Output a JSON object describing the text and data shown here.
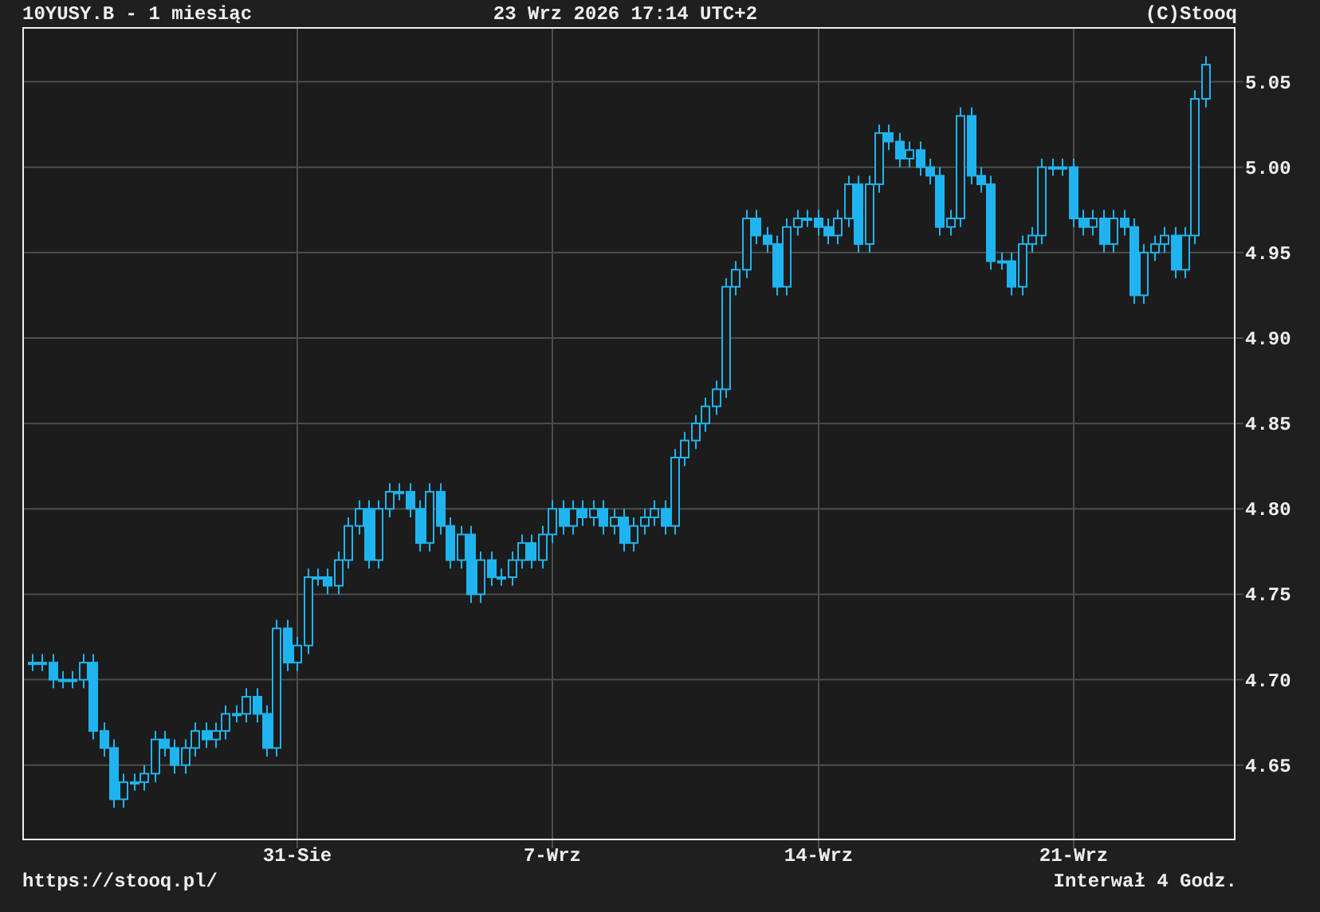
{
  "header": {
    "title": "10YUSY.B - 1 miesiąc",
    "timestamp": "23 Wrz 2026 17:14 UTC+2",
    "copyright": "(C)Stooq"
  },
  "chart": {
    "chart_data": {
      "type": "candlestick",
      "grid": true,
      "ylim": [
        4.606,
        5.082
      ],
      "yticks": [
        {
          "value": 4.65,
          "label": "4.65"
        },
        {
          "value": 4.7,
          "label": "4.70"
        },
        {
          "value": 4.75,
          "label": "4.75"
        },
        {
          "value": 4.8,
          "label": "4.80"
        },
        {
          "value": 4.85,
          "label": "4.85"
        },
        {
          "value": 4.9,
          "label": "4.90"
        },
        {
          "value": 4.95,
          "label": "4.95"
        },
        {
          "value": 5,
          "label": "5.00"
        },
        {
          "value": 5.05,
          "label": "5.05"
        }
      ],
      "categories": [
        null,
        null,
        null,
        null,
        null,
        null,
        null,
        null,
        null,
        null,
        null,
        null,
        null,
        null,
        null,
        null,
        null,
        null,
        null,
        null,
        null,
        null,
        null,
        null,
        null,
        null,
        "31-Sie",
        null,
        null,
        null,
        null,
        null,
        null,
        null,
        null,
        null,
        null,
        null,
        null,
        null,
        null,
        null,
        null,
        null,
        null,
        null,
        null,
        null,
        null,
        null,
        null,
        "7-Wrz",
        null,
        null,
        null,
        null,
        null,
        null,
        null,
        null,
        null,
        null,
        null,
        null,
        null,
        null,
        null,
        null,
        null,
        null,
        null,
        null,
        null,
        null,
        null,
        null,
        null,
        "14-Wrz",
        null,
        null,
        null,
        null,
        null,
        null,
        null,
        null,
        null,
        null,
        null,
        null,
        null,
        null,
        null,
        null,
        null,
        null,
        null,
        null,
        null,
        null,
        null,
        null,
        "21-Wrz",
        null,
        null,
        null,
        null,
        null,
        null,
        null,
        null,
        null,
        null,
        null,
        null,
        null
      ],
      "color": "#1fb4ef",
      "ohlc": [
        [
          4.71,
          4.715,
          4.705,
          4.71
        ],
        [
          4.71,
          4.715,
          4.705,
          4.71
        ],
        [
          4.71,
          4.715,
          4.695,
          4.7
        ],
        [
          4.7,
          4.705,
          4.695,
          4.7
        ],
        [
          4.7,
          4.705,
          4.695,
          4.7
        ],
        [
          4.7,
          4.715,
          4.695,
          4.71
        ],
        [
          4.71,
          4.715,
          4.665,
          4.67
        ],
        [
          4.67,
          4.675,
          4.655,
          4.66
        ],
        [
          4.66,
          4.665,
          4.625,
          4.63
        ],
        [
          4.63,
          4.645,
          4.625,
          4.64
        ],
        [
          4.64,
          4.645,
          4.635,
          4.64
        ],
        [
          4.64,
          4.65,
          4.635,
          4.645
        ],
        [
          4.645,
          4.67,
          4.64,
          4.665
        ],
        [
          4.665,
          4.67,
          4.655,
          4.66
        ],
        [
          4.66,
          4.665,
          4.645,
          4.65
        ],
        [
          4.65,
          4.665,
          4.645,
          4.66
        ],
        [
          4.66,
          4.675,
          4.655,
          4.67
        ],
        [
          4.67,
          4.675,
          4.66,
          4.665
        ],
        [
          4.665,
          4.675,
          4.66,
          4.67
        ],
        [
          4.67,
          4.685,
          4.665,
          4.68
        ],
        [
          4.68,
          4.685,
          4.675,
          4.68
        ],
        [
          4.68,
          4.695,
          4.675,
          4.69
        ],
        [
          4.69,
          4.695,
          4.675,
          4.68
        ],
        [
          4.68,
          4.685,
          4.655,
          4.66
        ],
        [
          4.66,
          4.735,
          4.655,
          4.73
        ],
        [
          4.73,
          4.735,
          4.705,
          4.71
        ],
        [
          4.71,
          4.725,
          4.705,
          4.72
        ],
        [
          4.72,
          4.765,
          4.715,
          4.76
        ],
        [
          4.76,
          4.765,
          4.755,
          4.76
        ],
        [
          4.76,
          4.765,
          4.75,
          4.755
        ],
        [
          4.755,
          4.775,
          4.75,
          4.77
        ],
        [
          4.77,
          4.795,
          4.765,
          4.79
        ],
        [
          4.79,
          4.805,
          4.785,
          4.8
        ],
        [
          4.8,
          4.805,
          4.765,
          4.77
        ],
        [
          4.77,
          4.805,
          4.765,
          4.8
        ],
        [
          4.8,
          4.815,
          4.795,
          4.81
        ],
        [
          4.81,
          4.815,
          4.805,
          4.81
        ],
        [
          4.81,
          4.815,
          4.795,
          4.8
        ],
        [
          4.8,
          4.805,
          4.775,
          4.78
        ],
        [
          4.78,
          4.815,
          4.775,
          4.81
        ],
        [
          4.81,
          4.815,
          4.785,
          4.79
        ],
        [
          4.79,
          4.795,
          4.765,
          4.77
        ],
        [
          4.77,
          4.79,
          4.765,
          4.785
        ],
        [
          4.785,
          4.79,
          4.745,
          4.75
        ],
        [
          4.75,
          4.775,
          4.745,
          4.77
        ],
        [
          4.77,
          4.775,
          4.755,
          4.76
        ],
        [
          4.76,
          4.765,
          4.755,
          4.76
        ],
        [
          4.76,
          4.775,
          4.755,
          4.77
        ],
        [
          4.77,
          4.785,
          4.765,
          4.78
        ],
        [
          4.78,
          4.785,
          4.765,
          4.77
        ],
        [
          4.77,
          4.79,
          4.765,
          4.785
        ],
        [
          4.785,
          4.805,
          4.78,
          4.8
        ],
        [
          4.8,
          4.805,
          4.785,
          4.79
        ],
        [
          4.79,
          4.805,
          4.785,
          4.8
        ],
        [
          4.8,
          4.805,
          4.79,
          4.795
        ],
        [
          4.795,
          4.805,
          4.79,
          4.8
        ],
        [
          4.8,
          4.805,
          4.785,
          4.79
        ],
        [
          4.79,
          4.8,
          4.785,
          4.795
        ],
        [
          4.795,
          4.8,
          4.775,
          4.78
        ],
        [
          4.78,
          4.795,
          4.775,
          4.79
        ],
        [
          4.79,
          4.8,
          4.785,
          4.795
        ],
        [
          4.795,
          4.805,
          4.79,
          4.8
        ],
        [
          4.8,
          4.805,
          4.785,
          4.79
        ],
        [
          4.79,
          4.835,
          4.785,
          4.83
        ],
        [
          4.83,
          4.845,
          4.825,
          4.84
        ],
        [
          4.84,
          4.855,
          4.835,
          4.85
        ],
        [
          4.85,
          4.865,
          4.845,
          4.86
        ],
        [
          4.86,
          4.875,
          4.855,
          4.87
        ],
        [
          4.87,
          4.935,
          4.865,
          4.93
        ],
        [
          4.93,
          4.945,
          4.925,
          4.94
        ],
        [
          4.94,
          4.975,
          4.935,
          4.97
        ],
        [
          4.97,
          4.975,
          4.955,
          4.96
        ],
        [
          4.96,
          4.965,
          4.95,
          4.955
        ],
        [
          4.955,
          4.96,
          4.925,
          4.93
        ],
        [
          4.93,
          4.97,
          4.925,
          4.965
        ],
        [
          4.965,
          4.975,
          4.96,
          4.97
        ],
        [
          4.97,
          4.975,
          4.965,
          4.97
        ],
        [
          4.97,
          4.975,
          4.96,
          4.965
        ],
        [
          4.965,
          4.97,
          4.955,
          4.96
        ],
        [
          4.96,
          4.975,
          4.955,
          4.97
        ],
        [
          4.97,
          4.995,
          4.965,
          4.99
        ],
        [
          4.99,
          4.995,
          4.95,
          4.955
        ],
        [
          4.955,
          4.995,
          4.95,
          4.99
        ],
        [
          4.99,
          5.025,
          4.985,
          5.02
        ],
        [
          5.02,
          5.025,
          5.01,
          5.015
        ],
        [
          5.015,
          5.02,
          5,
          5.005
        ],
        [
          5.005,
          5.015,
          5,
          5.01
        ],
        [
          5.01,
          5.015,
          4.995,
          5
        ],
        [
          5,
          5.005,
          4.99,
          4.995
        ],
        [
          4.995,
          5,
          4.96,
          4.965
        ],
        [
          4.965,
          4.975,
          4.96,
          4.97
        ],
        [
          4.97,
          5.035,
          4.965,
          5.03
        ],
        [
          5.03,
          5.035,
          4.99,
          4.995
        ],
        [
          4.995,
          5,
          4.985,
          4.99
        ],
        [
          4.99,
          4.995,
          4.94,
          4.945
        ],
        [
          4.945,
          4.95,
          4.94,
          4.945
        ],
        [
          4.945,
          4.95,
          4.925,
          4.93
        ],
        [
          4.93,
          4.96,
          4.925,
          4.955
        ],
        [
          4.955,
          4.965,
          4.95,
          4.96
        ],
        [
          4.96,
          5.005,
          4.955,
          5
        ],
        [
          5,
          5.005,
          4.995,
          5
        ],
        [
          5,
          5.005,
          4.995,
          5
        ],
        [
          5,
          5.005,
          4.965,
          4.97
        ],
        [
          4.97,
          4.975,
          4.96,
          4.965
        ],
        [
          4.965,
          4.975,
          4.96,
          4.97
        ],
        [
          4.97,
          4.975,
          4.95,
          4.955
        ],
        [
          4.955,
          4.975,
          4.95,
          4.97
        ],
        [
          4.97,
          4.975,
          4.96,
          4.965
        ],
        [
          4.965,
          4.97,
          4.92,
          4.925
        ],
        [
          4.925,
          4.955,
          4.92,
          4.95
        ],
        [
          4.95,
          4.96,
          4.945,
          4.955
        ],
        [
          4.955,
          4.965,
          4.95,
          4.96
        ],
        [
          4.96,
          4.965,
          4.935,
          4.94
        ],
        [
          4.94,
          4.965,
          4.935,
          4.96
        ],
        [
          4.96,
          5.045,
          4.955,
          5.04
        ],
        [
          5.04,
          5.065,
          5.035,
          5.06
        ]
      ]
    }
  },
  "footer": {
    "url": "https://stooq.pl/",
    "interval": "Interwał 4 Godz."
  }
}
